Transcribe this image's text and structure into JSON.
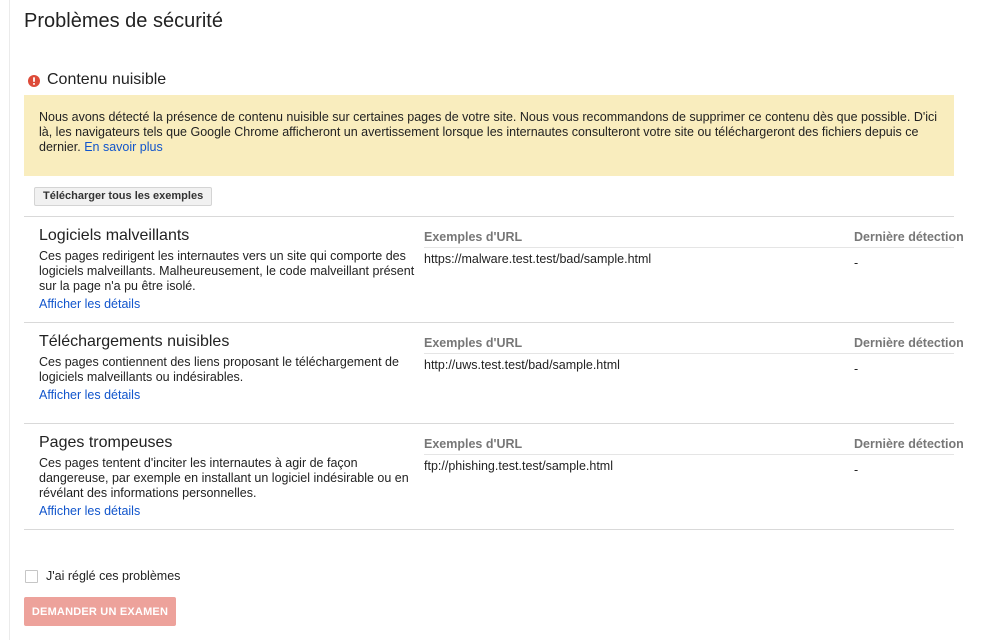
{
  "page": {
    "title": "Problèmes de sécurité"
  },
  "section": {
    "icon": "exclamation-circle-icon",
    "title": "Contenu nuisible",
    "accent": "#dd4b39"
  },
  "banner": {
    "text": "Nous avons détecté la présence de contenu nuisible sur certaines pages de votre site. Nous vous recommandons de supprimer ce contenu dès que possible. D'ici là, les navigateurs tels que Google Chrome afficheront un avertissement lorsque les internautes consulteront votre site ou téléchargeront des fichiers depuis ce dernier.",
    "link_label": "En savoir plus",
    "background": "#f9edbe"
  },
  "toolbar": {
    "download_label": "Télécharger tous les exemples"
  },
  "columns": {
    "url": "Exemples d'URL",
    "date": "Dernière détection"
  },
  "issues": [
    {
      "name": "Logiciels malveillants",
      "description": "Ces pages redirigent les internautes vers un site qui comporte des logiciels malveillants. Malheureusement, le code malveillant présent sur la page n'a pu être isolé.",
      "link": "Afficher les détails",
      "url": "https://malware.test.test/bad/sample.html",
      "date": "-"
    },
    {
      "name": "Téléchargements nuisibles",
      "description": "Ces pages contiennent des liens proposant le téléchargement de logiciels malveillants ou indésirables.",
      "link": "Afficher les détails",
      "url": "http://uws.test.test/bad/sample.html",
      "date": "-"
    },
    {
      "name": "Pages trompeuses",
      "description": "Ces pages tentent d'inciter les internautes à agir de façon dangereuse, par exemple en installant un logiciel indésirable ou en révélant des informations personnelles.",
      "link": "Afficher les détails",
      "url": "ftp://phishing.test.test/sample.html",
      "date": "-"
    }
  ],
  "footer": {
    "checkbox_label": "J'ai réglé ces problèmes",
    "checkbox_checked": false,
    "review_label": "DEMANDER UN EXAMEN",
    "review_color": "#eda29b"
  }
}
